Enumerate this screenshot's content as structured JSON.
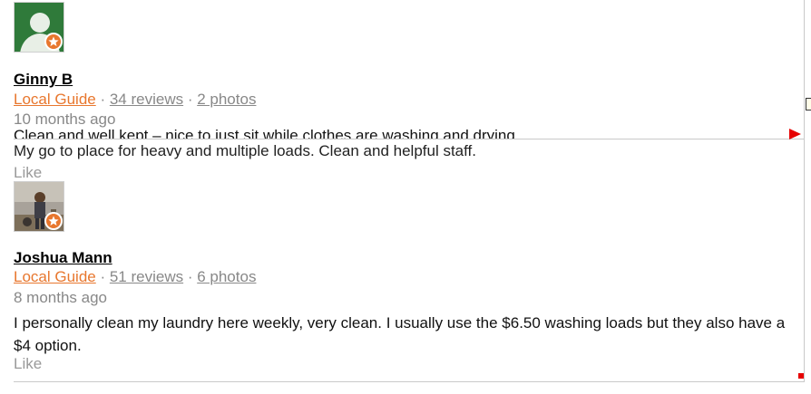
{
  "reviews": [
    {
      "name": "Ginny B",
      "local_guide": "Local Guide",
      "separator1": " · ",
      "reviews": "34 reviews",
      "separator2": " · ",
      "photos": "2 photos",
      "time": "10 months ago",
      "text": "Clean and well kept – nice to just sit while clothes are washing and drying"
    },
    {
      "name": "Joshua Mann",
      "local_guide": "Local Guide",
      "separator1": " · ",
      "reviews": "51 reviews",
      "separator2": " · ",
      "photos": "6 photos",
      "time": "8 months ago",
      "text": "I personally clean my laundry here weekly, very clean. I usually use the $6.50 washing loads but they also have a $4 option.",
      "like": "Like"
    }
  ],
  "overlay_review": {
    "text": "My go to place for heavy and multiple loads. Clean and helpful staff.",
    "like": "Like"
  },
  "icons": {
    "avatar1": "user-placeholder-avatar",
    "avatar2": "user-photo-avatar",
    "badge": "local-guide-star-icon"
  },
  "colors": {
    "accent": "#e8772e",
    "avatar_green": "#2f7a3a",
    "muted": "#888888"
  }
}
